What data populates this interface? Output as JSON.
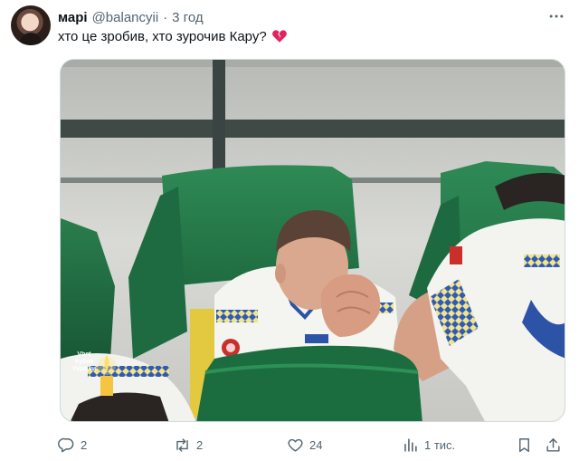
{
  "author": {
    "name": "марі",
    "handle": "@balancyii",
    "separator": "·",
    "time": "3 год"
  },
  "tweet": {
    "text": "хто це зробив, хто зурочив Кару?",
    "emoji": "broken-heart"
  },
  "media": {
    "watermark_lines": [
      "Vbet",
      "Кубок",
      "України"
    ]
  },
  "actions": {
    "replies": "2",
    "retweets": "2",
    "likes": "24",
    "views": "1 тис."
  },
  "icons": {
    "more": "more-icon",
    "reply": "reply-icon",
    "retweet": "retweet-icon",
    "like": "like-icon",
    "views": "views-icon",
    "bookmark": "bookmark-icon",
    "share": "share-icon"
  },
  "colors": {
    "text": "#0f1419",
    "secondary": "#536471",
    "broken_heart": "#e0245e"
  }
}
